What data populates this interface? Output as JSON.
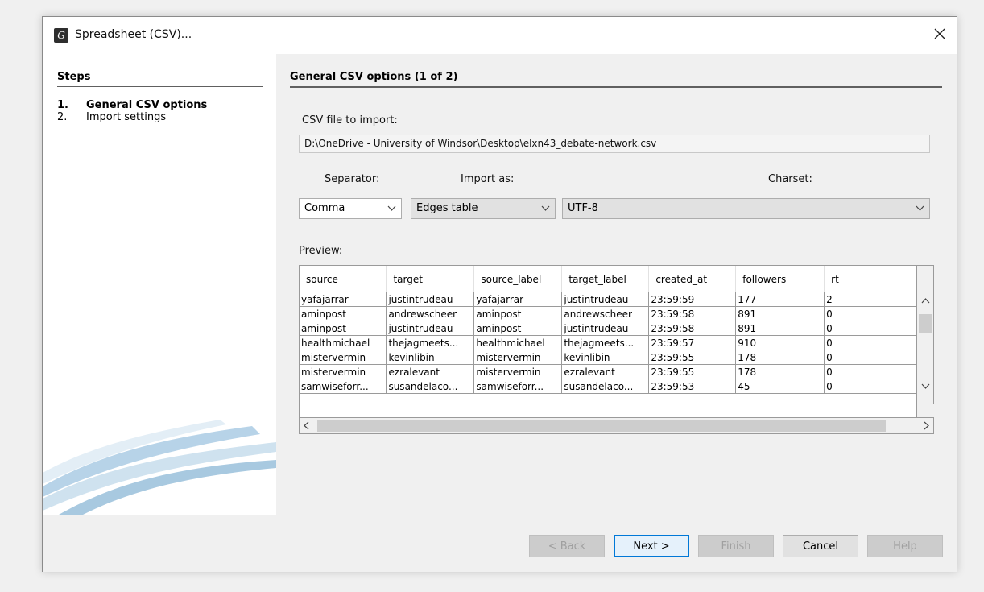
{
  "window": {
    "title": "Spreadsheet (CSV)...",
    "app_icon_glyph": "G"
  },
  "steps": {
    "header": "Steps",
    "items": [
      {
        "num": "1.",
        "label": "General CSV options",
        "active": true
      },
      {
        "num": "2.",
        "label": "Import settings",
        "active": false
      }
    ]
  },
  "panel": {
    "header": "General CSV options (1 of 2)",
    "file_label": "CSV file to import:",
    "file_path": "D:\\OneDrive - University of Windsor\\Desktop\\elxn43_debate-network.csv",
    "separator_label": "Separator:",
    "import_as_label": "Import as:",
    "charset_label": "Charset:",
    "separator_value": "Comma",
    "import_as_value": "Edges table",
    "charset_value": "UTF-8",
    "preview_label": "Preview:"
  },
  "preview": {
    "columns": [
      "source",
      "target",
      "source_label",
      "target_label",
      "created_at",
      "followers",
      "rt"
    ],
    "rows": [
      [
        "yafajarrar",
        "justintrudeau",
        "yafajarrar",
        "justintrudeau",
        "23:59:59",
        "177",
        "2"
      ],
      [
        "aminpost",
        "andrewscheer",
        "aminpost",
        "andrewscheer",
        "23:59:58",
        "891",
        "0"
      ],
      [
        "aminpost",
        "justintrudeau",
        "aminpost",
        "justintrudeau",
        "23:59:58",
        "891",
        "0"
      ],
      [
        "healthmichael",
        "thejagmeets...",
        "healthmichael",
        "thejagmeets...",
        "23:59:57",
        "910",
        "0"
      ],
      [
        "mistervermin",
        "kevinlibin",
        "mistervermin",
        "kevinlibin",
        "23:59:55",
        "178",
        "0"
      ],
      [
        "mistervermin",
        "ezralevant",
        "mistervermin",
        "ezralevant",
        "23:59:55",
        "178",
        "0"
      ],
      [
        "samwiseforr...",
        "susandelaco...",
        "samwiseforr...",
        "susandelaco...",
        "23:59:53",
        "45",
        "0"
      ]
    ]
  },
  "buttons": {
    "back": "< Back",
    "next": "Next >",
    "finish": "Finish",
    "cancel": "Cancel",
    "help": "Help"
  },
  "colors": {
    "accent": "#0078d7",
    "dialog_bg": "#f0f0f0",
    "deco": "#9fc3dc"
  }
}
